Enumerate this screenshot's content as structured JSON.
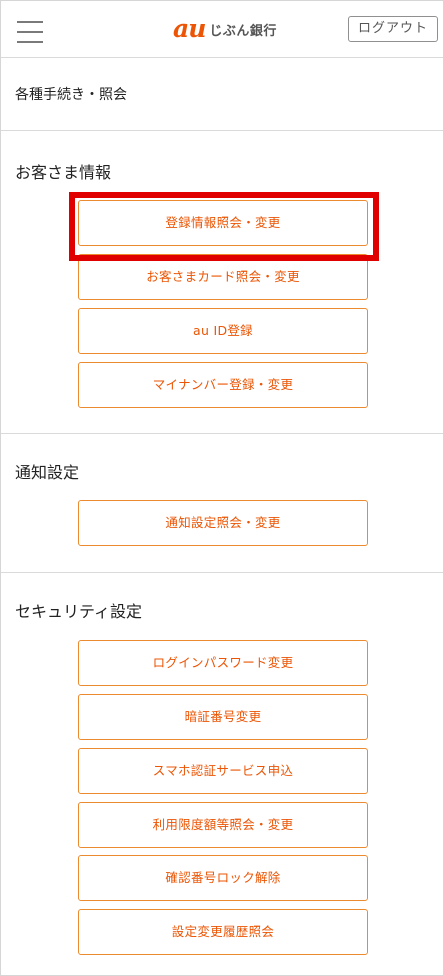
{
  "header": {
    "logo_mark": "au",
    "logo_text": "じぶん銀行",
    "logout_label": "ログアウト"
  },
  "menu": {
    "label": "各種手続き・照会"
  },
  "sections": {
    "customer": {
      "title": "お客さま情報",
      "buttons": [
        "登録情報照会・変更",
        "お客さまカード照会・変更",
        "au ID登録",
        "マイナンバー登録・変更"
      ]
    },
    "notification": {
      "title": "通知設定",
      "buttons": [
        "通知設定照会・変更"
      ]
    },
    "security": {
      "title": "セキュリティ設定",
      "buttons": [
        "ログインパスワード変更",
        "暗証番号変更",
        "スマホ認証サービス申込",
        "利用限度額等照会・変更",
        "確認番号ロック解除",
        "設定変更履歴照会"
      ]
    }
  },
  "colors": {
    "accent": "#eb5505",
    "button_border": "#ec8a2f",
    "highlight": "#e00000"
  }
}
